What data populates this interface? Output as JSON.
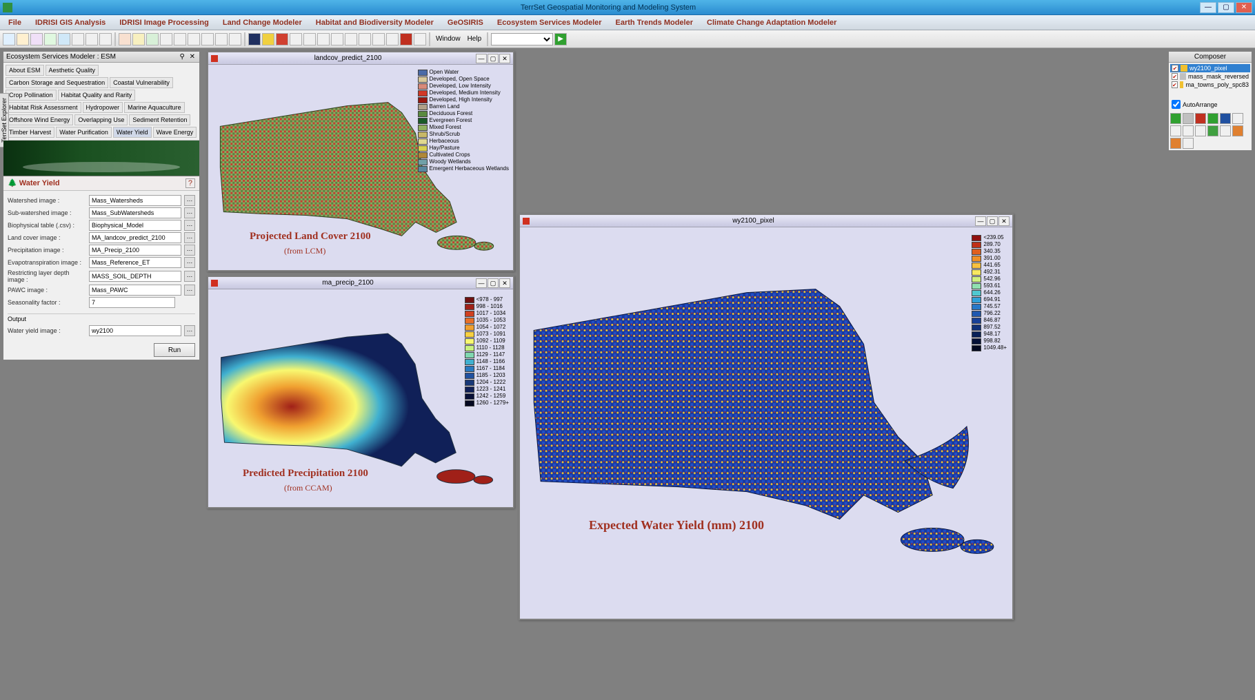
{
  "app": {
    "title": "TerrSet Geospatial Monitoring and Modeling System"
  },
  "modbar": {
    "items": [
      "File",
      "IDRISI GIS Analysis",
      "IDRISI Image Processing",
      "Land Change Modeler",
      "Habitat and Biodiversity Modeler",
      "GeOSIRIS",
      "Ecosystem Services Modeler",
      "Earth Trends Modeler",
      "Climate Change Adaptation Modeler"
    ]
  },
  "toolbar": {
    "window_label": "Window",
    "help_label": "Help"
  },
  "esm": {
    "title": "Ecosystem Services Modeler : ESM",
    "side_tab": "TerrSet Explorer",
    "tabs": [
      "About ESM",
      "Aesthetic Quality",
      "Carbon Storage and Sequestration",
      "Coastal Vulnerability",
      "Crop Pollination",
      "Habitat Quality and Rarity",
      "Habitat Risk Assessment",
      "Hydropower",
      "Marine Aquaculture",
      "Offshore Wind Energy",
      "Overlapping Use",
      "Sediment Retention",
      "Timber Harvest",
      "Water Purification",
      "Water Yield",
      "Wave Energy"
    ],
    "active_tab": "Water Yield",
    "section_title": "Water Yield",
    "fields": [
      {
        "label": "Watershed image :",
        "value": "Mass_Watersheds"
      },
      {
        "label": "Sub-watershed image :",
        "value": "Mass_SubWatersheds"
      },
      {
        "label": "Biophysical table (.csv) :",
        "value": "Biophysical_Model"
      },
      {
        "label": "Land cover image :",
        "value": "MA_landcov_predict_2100"
      },
      {
        "label": "Precipitation image :",
        "value": "MA_Precip_2100"
      },
      {
        "label": "Evapotranspiration image :",
        "value": "Mass_Reference_ET"
      },
      {
        "label": "Restricting layer depth image :",
        "value": "MASS_SOIL_DEPTH"
      },
      {
        "label": "PAWC image :",
        "value": "Mass_PAWC"
      },
      {
        "label": "Seasonality factor :",
        "value": "7"
      }
    ],
    "output_label": "Output",
    "output_field": {
      "label": "Water yield image :",
      "value": "wy2100"
    },
    "run_label": "Run"
  },
  "map1": {
    "title": "landcov_predict_2100",
    "caption": "Projected Land Cover 2100",
    "sub": "(from LCM)",
    "legend": [
      {
        "c": "#4a6aa8",
        "t": "Open Water"
      },
      {
        "c": "#d8c89a",
        "t": "Developed, Open Space"
      },
      {
        "c": "#d88a7a",
        "t": "Developed, Low Intensity"
      },
      {
        "c": "#d03828",
        "t": "Developed, Medium Intensity"
      },
      {
        "c": "#981810",
        "t": "Developed, High Intensity"
      },
      {
        "c": "#b0a088",
        "t": "Barren Land"
      },
      {
        "c": "#5a8a40",
        "t": "Deciduous Forest"
      },
      {
        "c": "#1a5a28",
        "t": "Evergreen Forest"
      },
      {
        "c": "#90b060",
        "t": "Mixed Forest"
      },
      {
        "c": "#c8b868",
        "t": "Shrub/Scrub"
      },
      {
        "c": "#e0d890",
        "t": "Herbaceous"
      },
      {
        "c": "#d8d050",
        "t": "Hay/Pasture"
      },
      {
        "c": "#b08838",
        "t": "Cultivated Crops"
      },
      {
        "c": "#70a0a8",
        "t": "Woody Wetlands"
      },
      {
        "c": "#5888a0",
        "t": "Emergent Herbaceous Wetlands"
      }
    ]
  },
  "map2": {
    "title": "ma_precip_2100",
    "caption": "Predicted Precipitation 2100",
    "sub": "(from CCAM)",
    "legend": [
      {
        "c": "#701010",
        "t": "<978 - 997"
      },
      {
        "c": "#a02018",
        "t": "998 - 1016"
      },
      {
        "c": "#d04020",
        "t": "1017 - 1034"
      },
      {
        "c": "#e87028",
        "t": "1035 - 1053"
      },
      {
        "c": "#f0a030",
        "t": "1054 - 1072"
      },
      {
        "c": "#f8d040",
        "t": "1073 - 1091"
      },
      {
        "c": "#f8f870",
        "t": "1092 - 1109"
      },
      {
        "c": "#c8f080",
        "t": "1110 - 1128"
      },
      {
        "c": "#80d8b0",
        "t": "1129 - 1147"
      },
      {
        "c": "#40b0d0",
        "t": "1148 - 1166"
      },
      {
        "c": "#2878c0",
        "t": "1167 - 1184"
      },
      {
        "c": "#2050a0",
        "t": "1185 - 1203"
      },
      {
        "c": "#183878",
        "t": "1204 - 1222"
      },
      {
        "c": "#102058",
        "t": "1223 - 1241"
      },
      {
        "c": "#081038",
        "t": "1242 - 1259"
      },
      {
        "c": "#040820",
        "t": "1260 - 1279+"
      }
    ]
  },
  "map3": {
    "title": "wy2100_pixel",
    "caption": "Expected Water Yield (mm) 2100",
    "legend": [
      {
        "c": "#901010",
        "t": "<239.05"
      },
      {
        "c": "#c03018",
        "t": "289.70"
      },
      {
        "c": "#e06020",
        "t": "340.35"
      },
      {
        "c": "#f09028",
        "t": "391.00"
      },
      {
        "c": "#f8c040",
        "t": "441.65"
      },
      {
        "c": "#f8e860",
        "t": "492.31"
      },
      {
        "c": "#d0f080",
        "t": "542.96"
      },
      {
        "c": "#90e0b0",
        "t": "593.61"
      },
      {
        "c": "#50c8d0",
        "t": "644.26"
      },
      {
        "c": "#30a0d8",
        "t": "694.91"
      },
      {
        "c": "#2878c8",
        "t": "745.57"
      },
      {
        "c": "#2058b0",
        "t": "796.22"
      },
      {
        "c": "#184098",
        "t": "846.87"
      },
      {
        "c": "#103078",
        "t": "897.52"
      },
      {
        "c": "#082058",
        "t": "948.17"
      },
      {
        "c": "#041038",
        "t": "998.82"
      },
      {
        "c": "#020820",
        "t": "1049.48+"
      }
    ]
  },
  "composer": {
    "title": "Composer",
    "items": [
      {
        "label": "wy2100_pixel",
        "sel": true,
        "color": "#f0c030"
      },
      {
        "label": "mass_mask_reversed",
        "sel": false,
        "color": "#c0c0c0"
      },
      {
        "label": "ma_towns_poly_spc83",
        "sel": false,
        "color": "#f0c030"
      }
    ],
    "auto_arrange": "AutoArrange"
  }
}
